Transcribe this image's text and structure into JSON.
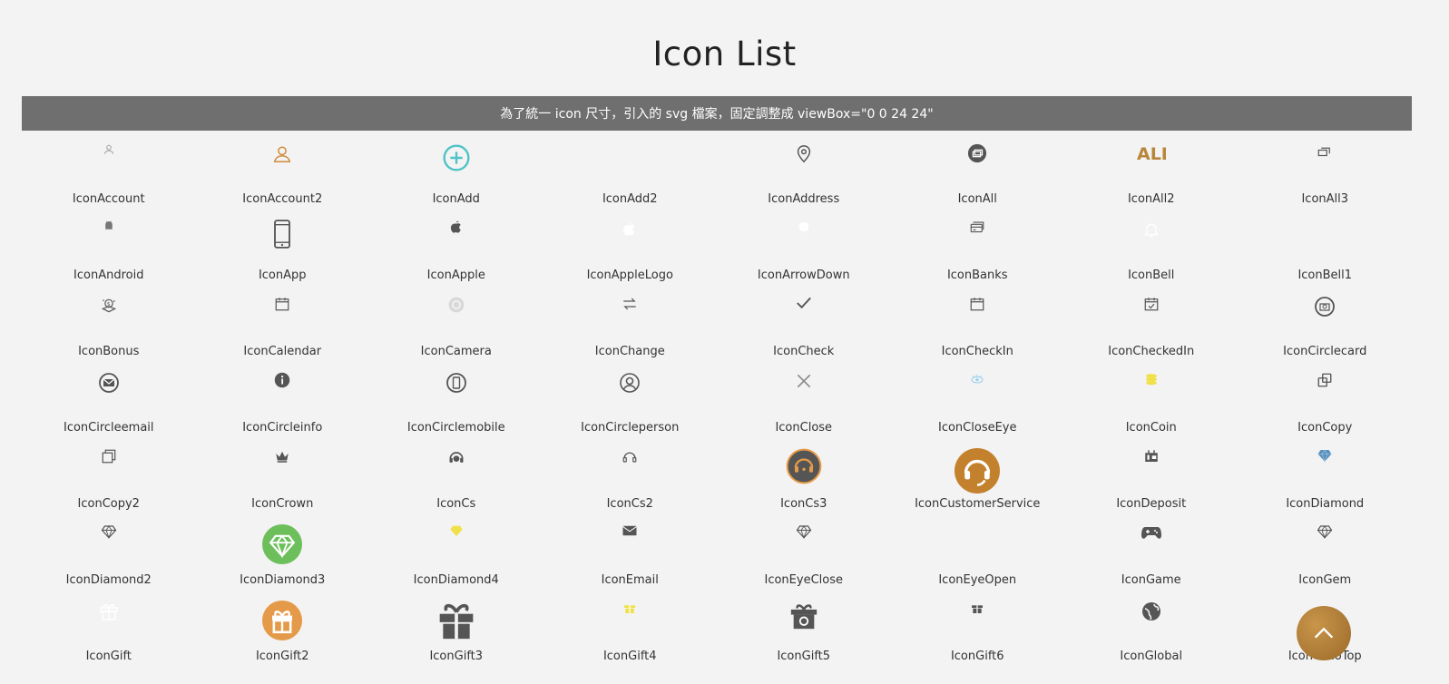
{
  "page": {
    "title": "Icon List",
    "notice": "為了統一 icon 尺寸，引入的 svg 檔案，固定調整成 viewBox=\"0 0 24 24\""
  },
  "icons": [
    {
      "label": "IconAccount",
      "icon": "account-icon"
    },
    {
      "label": "IconAccount2",
      "icon": "account2-icon"
    },
    {
      "label": "IconAdd",
      "icon": "add-icon"
    },
    {
      "label": "IconAdd2",
      "icon": "add2-icon"
    },
    {
      "label": "IconAddress",
      "icon": "address-icon"
    },
    {
      "label": "IconAll",
      "icon": "all-icon"
    },
    {
      "label": "IconAll2",
      "icon": "all2-icon"
    },
    {
      "label": "IconAll3",
      "icon": "all3-icon"
    },
    {
      "label": "IconAndroid",
      "icon": "android-icon"
    },
    {
      "label": "IconApp",
      "icon": "app-icon"
    },
    {
      "label": "IconApple",
      "icon": "apple-icon"
    },
    {
      "label": "IconAppleLogo",
      "icon": "apple-logo-icon"
    },
    {
      "label": "IconArrowDown",
      "icon": "arrow-down-icon"
    },
    {
      "label": "IconBanks",
      "icon": "banks-icon"
    },
    {
      "label": "IconBell",
      "icon": "bell-icon"
    },
    {
      "label": "IconBell1",
      "icon": "bell1-icon"
    },
    {
      "label": "IconBonus",
      "icon": "bonus-icon"
    },
    {
      "label": "IconCalendar",
      "icon": "calendar-icon"
    },
    {
      "label": "IconCamera",
      "icon": "camera-icon"
    },
    {
      "label": "IconChange",
      "icon": "change-icon"
    },
    {
      "label": "IconCheck",
      "icon": "check-icon"
    },
    {
      "label": "IconCheckIn",
      "icon": "check-in-icon"
    },
    {
      "label": "IconCheckedIn",
      "icon": "checked-in-icon"
    },
    {
      "label": "IconCirclecard",
      "icon": "circle-card-icon"
    },
    {
      "label": "IconCircleemail",
      "icon": "circle-email-icon"
    },
    {
      "label": "IconCircleinfo",
      "icon": "circle-info-icon"
    },
    {
      "label": "IconCirclemobile",
      "icon": "circle-mobile-icon"
    },
    {
      "label": "IconCircleperson",
      "icon": "circle-person-icon"
    },
    {
      "label": "IconClose",
      "icon": "close-icon"
    },
    {
      "label": "IconCloseEye",
      "icon": "close-eye-icon"
    },
    {
      "label": "IconCoin",
      "icon": "coin-icon"
    },
    {
      "label": "IconCopy",
      "icon": "copy-icon"
    },
    {
      "label": "IconCopy2",
      "icon": "copy2-icon"
    },
    {
      "label": "IconCrown",
      "icon": "crown-icon"
    },
    {
      "label": "IconCs",
      "icon": "cs-icon"
    },
    {
      "label": "IconCs2",
      "icon": "cs2-icon"
    },
    {
      "label": "IconCs3",
      "icon": "cs3-icon"
    },
    {
      "label": "IconCustomerService",
      "icon": "customer-service-icon"
    },
    {
      "label": "IconDeposit",
      "icon": "deposit-icon"
    },
    {
      "label": "IconDiamond",
      "icon": "diamond-icon"
    },
    {
      "label": "IconDiamond2",
      "icon": "diamond2-icon"
    },
    {
      "label": "IconDiamond3",
      "icon": "diamond3-icon"
    },
    {
      "label": "IconDiamond4",
      "icon": "diamond4-icon"
    },
    {
      "label": "IconEmail",
      "icon": "email-icon"
    },
    {
      "label": "IconEyeClose",
      "icon": "eye-close-icon"
    },
    {
      "label": "IconEyeOpen",
      "icon": "eye-open-icon"
    },
    {
      "label": "IconGame",
      "icon": "game-icon"
    },
    {
      "label": "IconGem",
      "icon": "gem-icon"
    },
    {
      "label": "IconGift",
      "icon": "gift-icon"
    },
    {
      "label": "IconGift2",
      "icon": "gift2-icon"
    },
    {
      "label": "IconGift3",
      "icon": "gift3-icon"
    },
    {
      "label": "IconGift4",
      "icon": "gift4-icon"
    },
    {
      "label": "IconGift5",
      "icon": "gift5-icon"
    },
    {
      "label": "IconGift6",
      "icon": "gift6-icon"
    },
    {
      "label": "IconGlobal",
      "icon": "global-icon"
    },
    {
      "label": "IconGoToTop",
      "icon": "go-to-top-icon"
    }
  ],
  "colors": {
    "background": "#f3f3f3",
    "notice_bar": "#6f6f6f",
    "gold": "#b8863a",
    "orange": "#e49a48",
    "teal": "#4fc3c7",
    "green": "#6cbf5b",
    "yellow": "#f0e04a",
    "dark": "#555555"
  },
  "go_to_top_icon": "chevron-up-icon"
}
